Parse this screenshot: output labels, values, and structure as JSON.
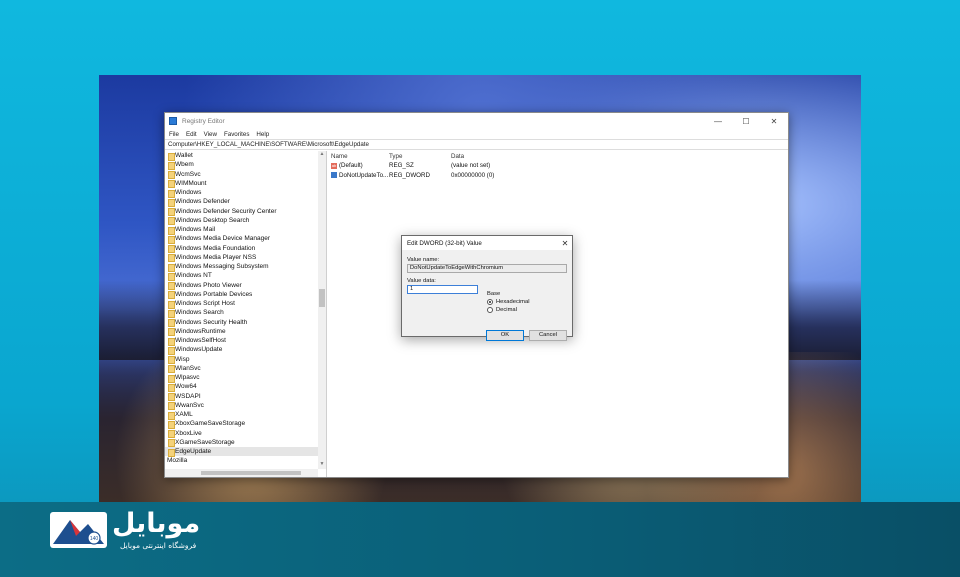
{
  "registry": {
    "title": "Registry Editor",
    "menu": [
      "File",
      "Edit",
      "View",
      "Favorites",
      "Help"
    ],
    "address": "Computer\\HKEY_LOCAL_MACHINE\\SOFTWARE\\Microsoft\\EdgeUpdate",
    "tree_items": [
      "Wallet",
      "Wbem",
      "WcmSvc",
      "WIMMount",
      "Windows",
      "Windows Defender",
      "Windows Defender Security Center",
      "Windows Desktop Search",
      "Windows Mail",
      "Windows Media Device Manager",
      "Windows Media Foundation",
      "Windows Media Player NSS",
      "Windows Messaging Subsystem",
      "Windows NT",
      "Windows Photo Viewer",
      "Windows Portable Devices",
      "Windows Script Host",
      "Windows Search",
      "Windows Security Health",
      "WindowsRuntime",
      "WindowsSelfHost",
      "WindowsUpdate",
      "Wisp",
      "WlanSvc",
      "Wlpasvc",
      "Wow64",
      "WSDAPI",
      "WwanSvc",
      "XAML",
      "XboxGameSaveStorage",
      "XboxLive",
      "XGameSaveStorage",
      "EdgeUpdate"
    ],
    "tree_root_after": "Mozilla",
    "selected_item": "EdgeUpdate",
    "columns": {
      "name": "Name",
      "type": "Type",
      "data": "Data"
    },
    "values": [
      {
        "name": "(Default)",
        "type": "REG_SZ",
        "data": "(value not set)",
        "icon": "string-value-icon"
      },
      {
        "name": "DoNotUpdateTo...",
        "type": "REG_DWORD",
        "data": "0x00000000 (0)",
        "icon": "dword-value-icon"
      }
    ]
  },
  "dialog": {
    "title": "Edit DWORD (32-bit) Value",
    "value_name_label": "Value name:",
    "value_name": "DoNotUpdateToEdgeWithChromium",
    "value_data_label": "Value data:",
    "value_data": "1",
    "base_label": "Base",
    "base_options": [
      "Hexadecimal",
      "Decimal"
    ],
    "base_selected": "Hexadecimal",
    "ok_label": "OK",
    "cancel_label": "Cancel"
  },
  "brand": {
    "name": "موبایل",
    "tagline": "فروشگاه اینترنتی موبایل",
    "accent": "#1e4f8f",
    "logo_badge": "140"
  },
  "colors": {
    "page_background": "#10b8df",
    "bottom_band": "#0a5f78",
    "selection": "#e5e5e5",
    "focus_border": "#3c7fd8"
  }
}
